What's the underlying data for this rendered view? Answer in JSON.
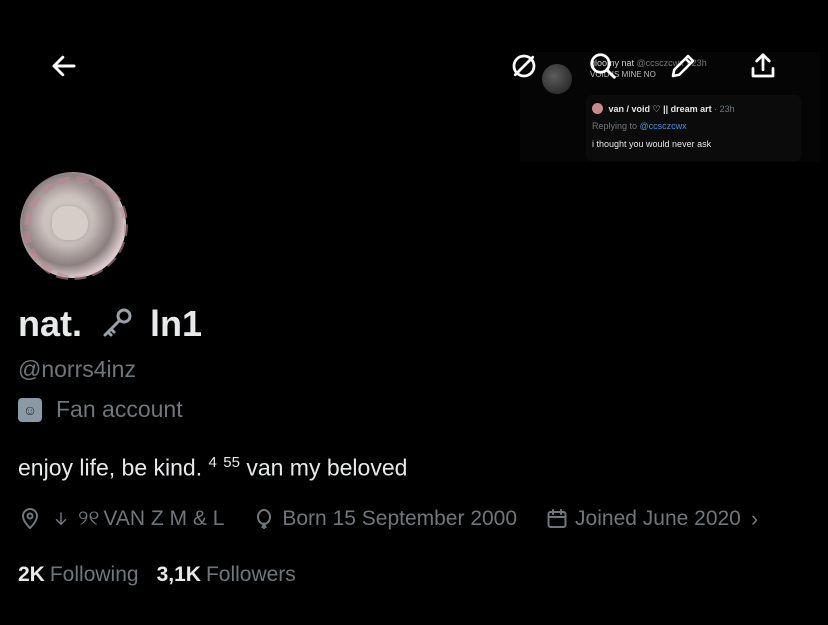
{
  "header": {
    "back_icon": "arrow-left-icon",
    "actions": [
      "hide-icon",
      "search-icon",
      "edit-icon",
      "share-icon"
    ]
  },
  "banner_embed": {
    "author": "gloomy nat",
    "handle_time": "@ccsczcwx · 23h",
    "line2": "VOID IS MINE NO",
    "quote_name": "van / void ♡ || dream art",
    "quote_time": "· 23h",
    "replying_label": "Replying to",
    "replying_handle": "@ccsczcwx",
    "quote_text": "i thought you would never ask"
  },
  "profile": {
    "name_part1": "nat.",
    "name_part2": "ln1",
    "handle": "@norrs4inz",
    "category": "Fan account",
    "bio_text1": "enjoy life, be kind.",
    "bio_sup1": "4",
    "bio_sup2": "55",
    "bio_text2": "van my beloved",
    "location": "VAN Z M & L",
    "location_prefix": "୨୧",
    "born": "Born 15 September 2000",
    "joined": "Joined June 2020"
  },
  "stats": {
    "following_count": "2K",
    "following_label": "Following",
    "followers_count": "3,1K",
    "followers_label": "Followers"
  },
  "colors": {
    "background": "#000000",
    "primary_text": "#e7e9ea",
    "secondary_text": "#71767b"
  }
}
